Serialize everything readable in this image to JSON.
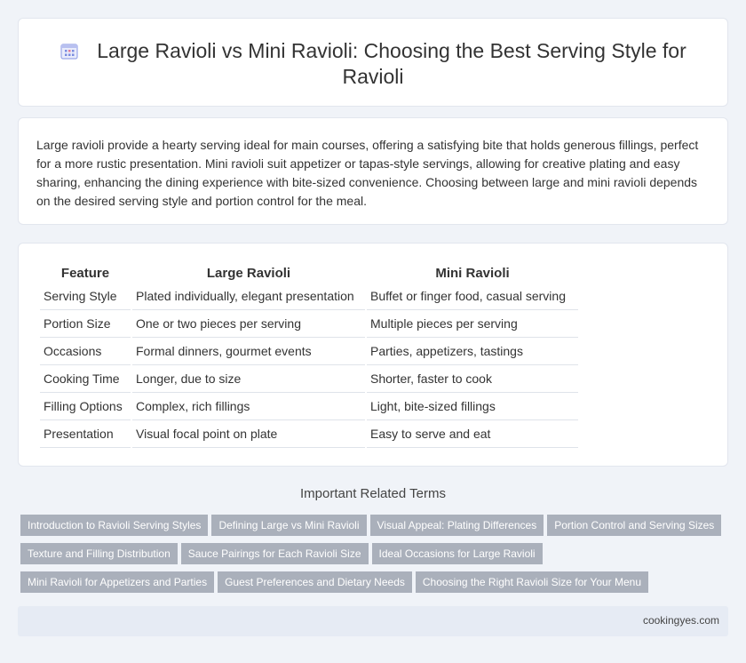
{
  "header": {
    "title": "Large Ravioli vs Mini Ravioli: Choosing the Best Serving Style for Ravioli"
  },
  "intro": {
    "text": "Large ravioli provide a hearty serving ideal for main courses, offering a satisfying bite that holds generous fillings, perfect for a more rustic presentation. Mini ravioli suit appetizer or tapas-style servings, allowing for creative plating and easy sharing, enhancing the dining experience with bite-sized convenience. Choosing between large and mini ravioli depends on the desired serving style and portion control for the meal."
  },
  "table": {
    "headers": [
      "Feature",
      "Large Ravioli",
      "Mini Ravioli"
    ],
    "rows": [
      [
        "Serving Style",
        "Plated individually, elegant presentation",
        "Buffet or finger food, casual serving"
      ],
      [
        "Portion Size",
        "One or two pieces per serving",
        "Multiple pieces per serving"
      ],
      [
        "Occasions",
        "Formal dinners, gourmet events",
        "Parties, appetizers, tastings"
      ],
      [
        "Cooking Time",
        "Longer, due to size",
        "Shorter, faster to cook"
      ],
      [
        "Filling Options",
        "Complex, rich fillings",
        "Light, bite-sized fillings"
      ],
      [
        "Presentation",
        "Visual focal point on plate",
        "Easy to serve and eat"
      ]
    ]
  },
  "related": {
    "title": "Important Related Terms",
    "tags": [
      [
        "Introduction to Ravioli Serving Styles",
        "Defining Large vs Mini Ravioli",
        "Visual Appeal: Plating Differences",
        "Portion Control and Serving Sizes"
      ],
      [
        "Texture and Filling Distribution",
        "Sauce Pairings for Each Ravioli Size",
        "Ideal Occasions for Large Ravioli"
      ],
      [
        "Mini Ravioli for Appetizers and Parties",
        "Guest Preferences and Dietary Needs",
        "Choosing the Right Ravioli Size for Your Menu"
      ]
    ]
  },
  "footer": {
    "site": "cookingyes.com"
  },
  "colors": {
    "background": "#f0f3f8",
    "tag_bg": "#aab0bb",
    "icon_accent": "#7b8de0"
  },
  "icons": {
    "title_icon": "calendar-icon"
  }
}
